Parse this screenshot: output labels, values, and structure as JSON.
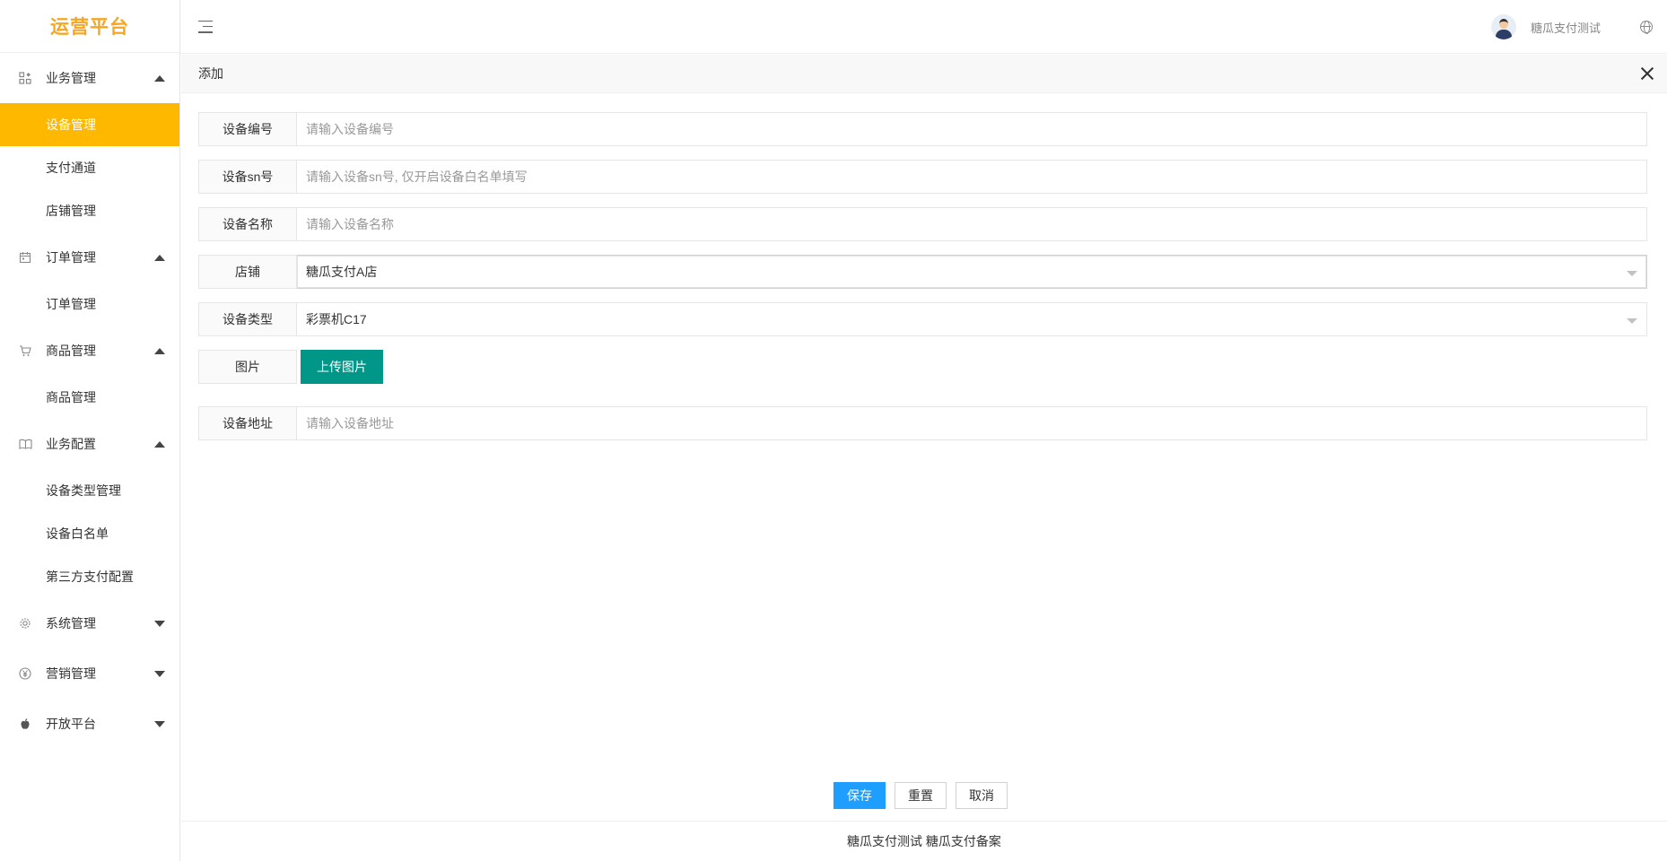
{
  "logo": {
    "text": "运营平台"
  },
  "header": {
    "user_name": "糖瓜支付测试"
  },
  "sidebar": {
    "groups": [
      {
        "label": "业务管理",
        "icon": "grid-icon",
        "expanded": true,
        "items": [
          {
            "label": "设备管理",
            "active": true
          },
          {
            "label": "支付通道"
          },
          {
            "label": "店铺管理"
          }
        ]
      },
      {
        "label": "订单管理",
        "icon": "calendar-icon",
        "expanded": true,
        "items": [
          {
            "label": "订单管理"
          }
        ]
      },
      {
        "label": "商品管理",
        "icon": "cart-icon",
        "expanded": true,
        "items": [
          {
            "label": "商品管理"
          }
        ]
      },
      {
        "label": "业务配置",
        "icon": "book-icon",
        "expanded": true,
        "items": [
          {
            "label": "设备类型管理"
          },
          {
            "label": "设备白名单"
          },
          {
            "label": "第三方支付配置"
          }
        ]
      },
      {
        "label": "系统管理",
        "icon": "gear-icon",
        "expanded": false,
        "items": []
      },
      {
        "label": "营销管理",
        "icon": "yen-icon",
        "expanded": false,
        "items": []
      },
      {
        "label": "开放平台",
        "icon": "apple-icon",
        "expanded": false,
        "items": []
      }
    ]
  },
  "dialog": {
    "title": "添加",
    "fields": {
      "device_no": {
        "label": "设备编号",
        "placeholder": "请输入设备编号"
      },
      "device_sn": {
        "label": "设备sn号",
        "placeholder": "请输入设备sn号, 仅开启设备白名单填写"
      },
      "device_name": {
        "label": "设备名称",
        "placeholder": "请输入设备名称"
      },
      "store": {
        "label": "店铺",
        "value": "糖瓜支付A店"
      },
      "device_type": {
        "label": "设备类型",
        "value": "彩票机C17"
      },
      "image": {
        "label": "图片",
        "button": "上传图片"
      },
      "address": {
        "label": "设备地址",
        "placeholder": "请输入设备地址"
      }
    },
    "actions": {
      "save": "保存",
      "reset": "重置",
      "cancel": "取消"
    }
  },
  "footer": {
    "text": "糖瓜支付测试 糖瓜支付备案"
  },
  "colors": {
    "accent": "#ffb800",
    "logo": "#f5a623",
    "upload": "#009688",
    "primary": "#1e9fff"
  }
}
